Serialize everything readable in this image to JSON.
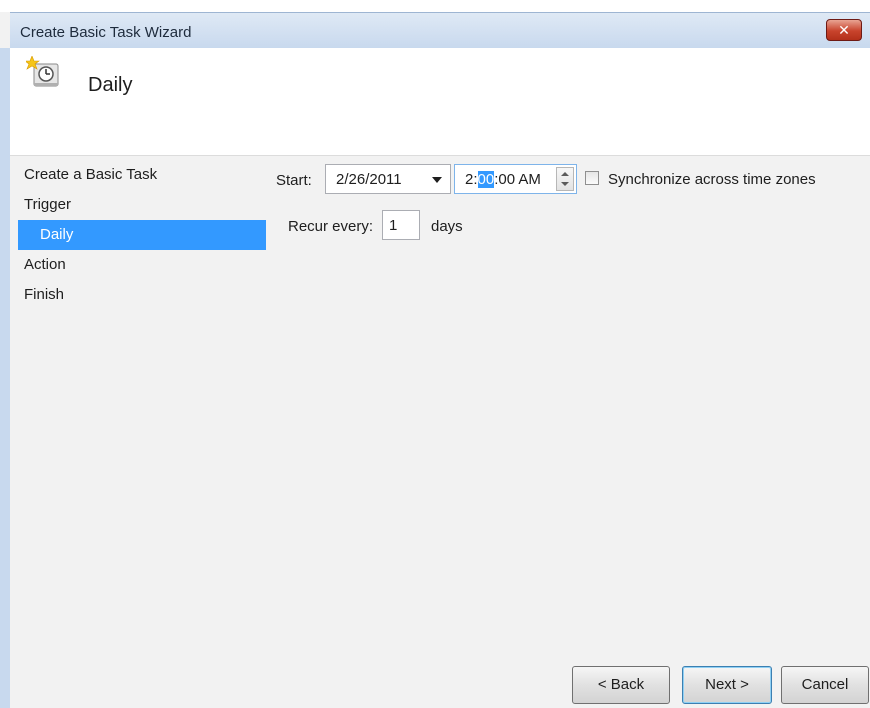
{
  "window": {
    "title": "Create Basic Task Wizard",
    "close_label": "✕"
  },
  "header": {
    "heading": "Daily",
    "icon": "task-scheduler-clock-icon"
  },
  "steps": [
    {
      "label": "Create a Basic Task",
      "level": 0,
      "active": false
    },
    {
      "label": "Trigger",
      "level": 0,
      "active": false
    },
    {
      "label": "Daily",
      "level": 1,
      "active": true
    },
    {
      "label": "Action",
      "level": 0,
      "active": false
    },
    {
      "label": "Finish",
      "level": 0,
      "active": false
    }
  ],
  "form": {
    "start_label": "Start:",
    "start_date": "2/26/2011",
    "time_before": "2:",
    "time_selected": "00",
    "time_after": ":00 AM",
    "sync_label": "Synchronize across time zones",
    "sync_checked": false,
    "recur_label": "Recur every:",
    "recur_value": "1",
    "recur_unit": "days"
  },
  "buttons": {
    "back": "< Back",
    "next": "Next >",
    "cancel": "Cancel"
  },
  "colors": {
    "selection": "#3399ff",
    "close_button": "#c8432c"
  }
}
